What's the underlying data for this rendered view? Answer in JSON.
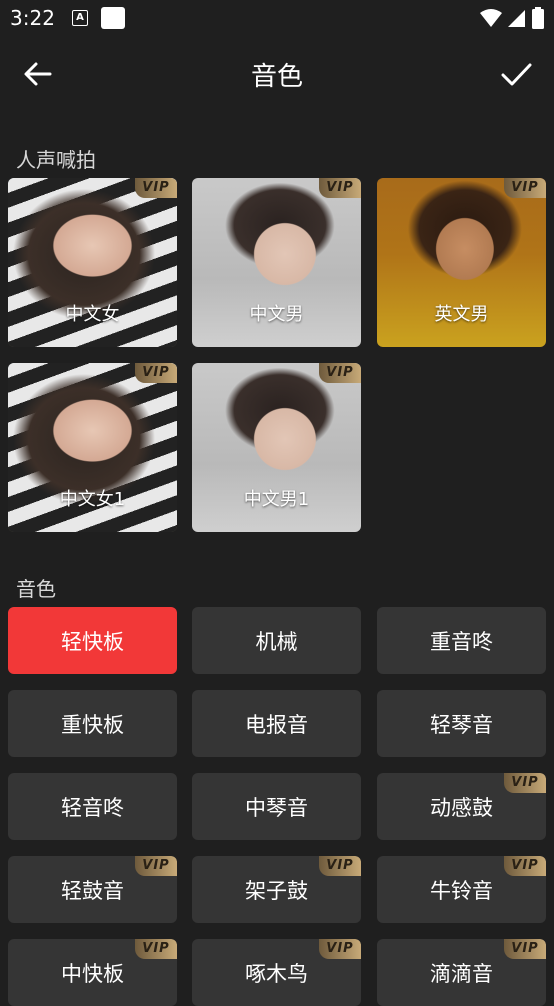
{
  "status_bar": {
    "time": "3:22",
    "notification_a": "A"
  },
  "header": {
    "title": "音色"
  },
  "sections": {
    "vocal_label": "人声喊拍",
    "tone_label": "音色"
  },
  "vip_text": "VIP",
  "vocal_cards": [
    {
      "label": "中文女",
      "vip": true,
      "theme": "female"
    },
    {
      "label": "中文男",
      "vip": true,
      "theme": "male"
    },
    {
      "label": "英文男",
      "vip": true,
      "theme": "english"
    },
    {
      "label": "中文女1",
      "vip": true,
      "theme": "female"
    },
    {
      "label": "中文男1",
      "vip": true,
      "theme": "male"
    }
  ],
  "tones": [
    {
      "label": "轻快板",
      "vip": false,
      "selected": true
    },
    {
      "label": "机械",
      "vip": false,
      "selected": false
    },
    {
      "label": "重音咚",
      "vip": false,
      "selected": false
    },
    {
      "label": "重快板",
      "vip": false,
      "selected": false
    },
    {
      "label": "电报音",
      "vip": false,
      "selected": false
    },
    {
      "label": "轻琴音",
      "vip": false,
      "selected": false
    },
    {
      "label": "轻音咚",
      "vip": false,
      "selected": false
    },
    {
      "label": "中琴音",
      "vip": false,
      "selected": false
    },
    {
      "label": "动感鼓",
      "vip": true,
      "selected": false
    },
    {
      "label": "轻鼓音",
      "vip": true,
      "selected": false
    },
    {
      "label": "架子鼓",
      "vip": true,
      "selected": false
    },
    {
      "label": "牛铃音",
      "vip": true,
      "selected": false
    },
    {
      "label": "中快板",
      "vip": true,
      "selected": false
    },
    {
      "label": "啄木鸟",
      "vip": true,
      "selected": false
    },
    {
      "label": "滴滴音",
      "vip": true,
      "selected": false
    }
  ],
  "colors": {
    "background": "#1f1f1f",
    "tile": "#353535",
    "selected": "#f23838",
    "vip_gold": "#c8aa78"
  }
}
